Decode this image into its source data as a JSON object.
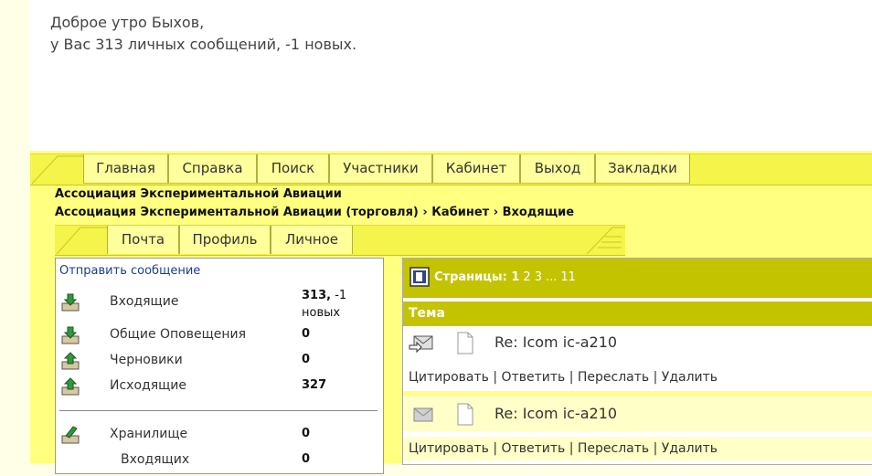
{
  "greeting": {
    "line1": "Доброе утро Быхов,",
    "line2": "у Вас 313 личных сообщений, -1 новых."
  },
  "main_tabs": [
    {
      "label": "Главная"
    },
    {
      "label": "Справка"
    },
    {
      "label": "Поиск"
    },
    {
      "label": "Участники"
    },
    {
      "label": "Кабинет"
    },
    {
      "label": "Выход"
    },
    {
      "label": "Закладки"
    }
  ],
  "breadcrumb": {
    "forum_title": "Ассоциация Экспериментальной Авиации",
    "path": [
      "Ассоциация Экспериментальной Авиации (торговля)",
      "Кабинет",
      "Входящие"
    ],
    "separator": "›"
  },
  "sub_tabs": [
    {
      "label": "Почта"
    },
    {
      "label": "Профиль"
    },
    {
      "label": "Личное"
    }
  ],
  "left_panel": {
    "send_message": "Отправить сообщение",
    "folders": [
      {
        "name": "Входящие",
        "count": "313,",
        "extra": " -1",
        "extra2": "новых",
        "icon": "inbox-download-icon"
      },
      {
        "name": "Общие Оповещения",
        "count": "0",
        "icon": "inbox-download-icon"
      },
      {
        "name": "Черновики",
        "count": "0",
        "icon": "inbox-upload-icon"
      },
      {
        "name": "Исходящие",
        "count": "327",
        "icon": "inbox-upload-icon"
      }
    ],
    "storage": {
      "name": "Хранилище",
      "count": "0",
      "icon": "storage-icon"
    },
    "storage_sub": {
      "name": "Входящих",
      "count": "0"
    }
  },
  "right_panel": {
    "pages_label": "Страницы:",
    "current_page": "1",
    "pages": [
      "2",
      "3",
      "...",
      "11"
    ],
    "theme_header": "Тема",
    "messages": [
      {
        "subject": "Re: Icom ic-a210",
        "icon": "forwarded-envelope-icon"
      },
      {
        "subject": "Re: Icom ic-a210",
        "icon": "envelope-icon"
      }
    ],
    "actions": [
      "Цитировать",
      "Ответить",
      "Переслать",
      "Удалить"
    ],
    "action_sep": "|"
  },
  "colors": {
    "tab_bar": "#f4f44a",
    "tab": "#ffff9c",
    "forum_bg": "#ffff80",
    "header_olive": "#c3c300",
    "link": "#1a3f8f"
  }
}
